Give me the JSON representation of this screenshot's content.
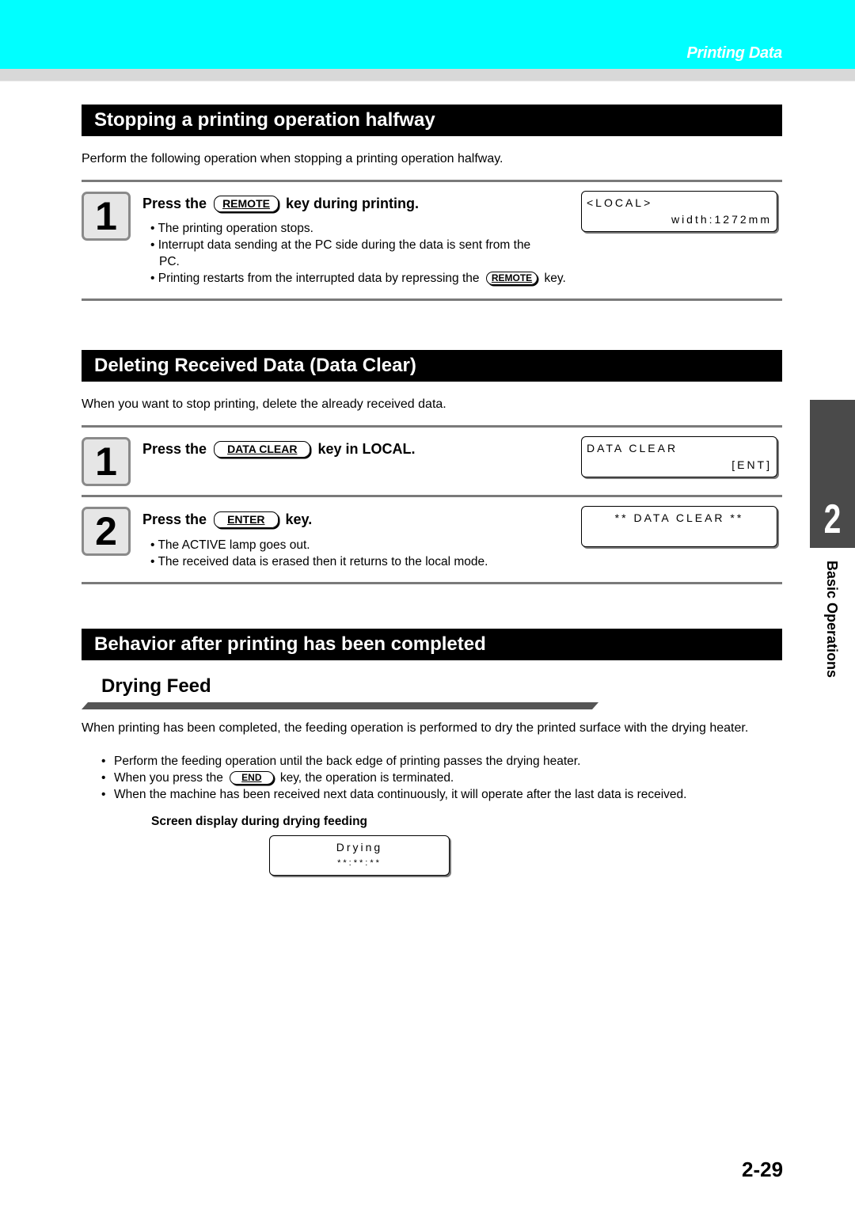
{
  "header": {
    "section_title": "Printing Data",
    "accent_color": "#00ffff"
  },
  "sections": {
    "stopping": {
      "title": "Stopping a printing operation halfway",
      "intro": "Perform the following operation when stopping a printing operation halfway.",
      "step1": {
        "number": "1",
        "title_pre": "Press the",
        "key": "REMOTE",
        "title_post": "key during printing.",
        "bullets": [
          "• The printing operation stops.",
          "• Interrupt data sending at the PC side during the data is sent from the",
          "PC.",
          "• Printing restarts from the interrupted data by repressing the"
        ],
        "bullet4_key": "REMOTE",
        "bullet4_post": "key.",
        "lcd": {
          "line1": "<LOCAL>",
          "line2": "width:1272mm"
        }
      }
    },
    "data_clear": {
      "title": "Deleting Received Data (Data Clear)",
      "intro": "When you want to stop printing, delete the already received data.",
      "step1": {
        "number": "1",
        "title_pre": "Press the",
        "key": "DATA CLEAR",
        "title_post": "key in LOCAL.",
        "lcd": {
          "line1": "DATA CLEAR",
          "line2": "[ENT]"
        }
      },
      "step2": {
        "number": "2",
        "title_pre": "Press the",
        "key": "ENTER",
        "title_post": "key.",
        "bullets": [
          "• The ACTIVE lamp goes out.",
          "• The received data is erased then it returns to the local mode."
        ],
        "lcd": {
          "line1": "** DATA CLEAR **",
          "line2": ""
        }
      }
    },
    "behavior": {
      "title": "Behavior after printing has been completed",
      "subtitle": "Drying Feed",
      "paragraph": "When printing has been completed, the feeding operation is performed to dry the printed surface with the drying heater.",
      "bullets": [
        {
          "text": "Perform the feeding operation until the back edge of printing passes the drying heater."
        },
        {
          "pre": "When you press the",
          "key": "END",
          "post": "key, the operation is terminated."
        },
        {
          "text": "When the machine has been received next data continuously, it will operate after the last data is received."
        }
      ],
      "screen_label": "Screen display during drying feeding",
      "lcd": {
        "line1": "Drying",
        "line2": "**:**:**"
      }
    }
  },
  "side_tab": {
    "chapter": "2",
    "label": "Basic Operations"
  },
  "footer": {
    "page_number": "2-29"
  }
}
